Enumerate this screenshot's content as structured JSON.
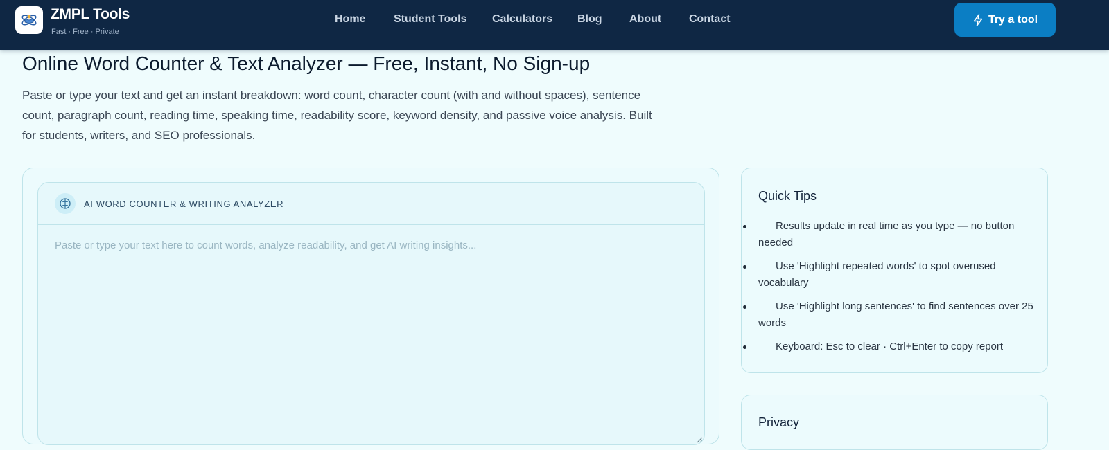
{
  "brand": {
    "name": "ZMPL Tools",
    "tagline": "Fast · Free · Private"
  },
  "nav": {
    "items": [
      "Home",
      "Student Tools",
      "Calculators",
      "Blog",
      "About",
      "Contact"
    ],
    "cta_label": "Try a tool"
  },
  "intro": {
    "title": "Online Word Counter & Text Analyzer — Free, Instant, No Sign-up",
    "description": "Paste or type your text and get an instant breakdown: word count, character count (with and without spaces), sentence count, paragraph count, reading time, speaking time, readability score, keyword density, and passive voice analysis. Built for students, writers, and SEO professionals."
  },
  "analyzer": {
    "title": "AI Word Counter & Writing Analyzer",
    "placeholder": "Paste or type your text here to count words, analyze readability, and get AI writing insights...",
    "value": ""
  },
  "quick_tips": {
    "title": "Quick Tips",
    "items": [
      "Results update in real time as you type — no button needed",
      "Use 'Highlight repeated words' to spot overused vocabulary",
      "Use 'Highlight long sentences' to find sentences over 25 words",
      "Keyboard: Esc to clear · Ctrl+Enter to copy report"
    ]
  },
  "privacy": {
    "title": "Privacy"
  },
  "colors": {
    "header_bg": "#0f2744",
    "accent": "#0b7ec4",
    "page_bg": "#effcfd",
    "card_border": "#bfe4ea"
  },
  "icons": {
    "logo": "atom-book-logo-icon",
    "cta": "lightning-bolt-icon",
    "analyzer": "brain-icon"
  }
}
